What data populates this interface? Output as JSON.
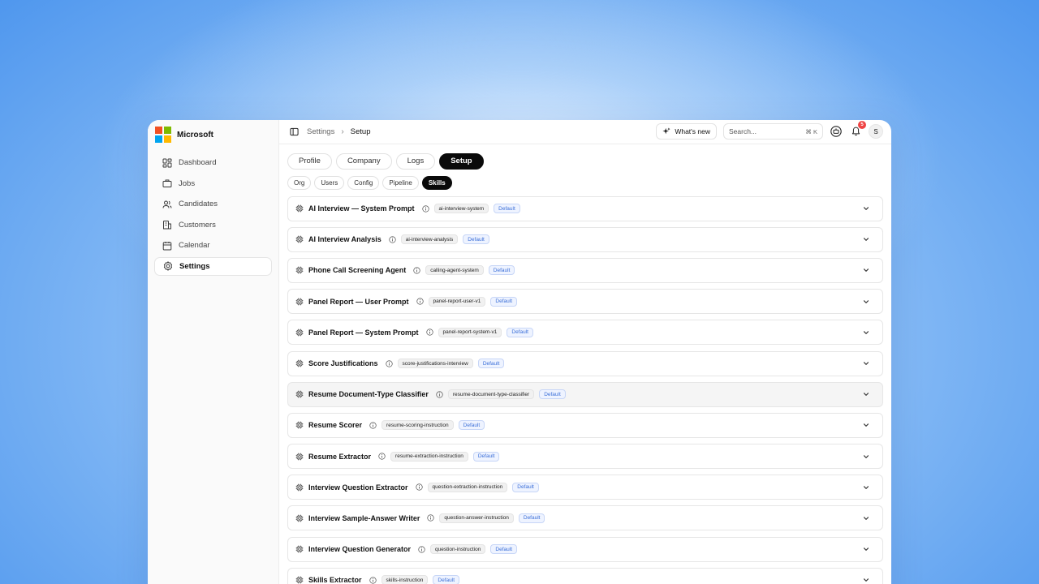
{
  "brand": {
    "name": "Microsoft",
    "logo_colors": [
      "#f25022",
      "#7fba00",
      "#00a4ef",
      "#ffb900"
    ]
  },
  "sidebar": {
    "items": [
      {
        "label": "Dashboard",
        "icon": "dashboard-icon"
      },
      {
        "label": "Jobs",
        "icon": "briefcase-icon"
      },
      {
        "label": "Candidates",
        "icon": "users-icon"
      },
      {
        "label": "Customers",
        "icon": "building-icon"
      },
      {
        "label": "Calendar",
        "icon": "calendar-icon"
      },
      {
        "label": "Settings",
        "icon": "gear-icon",
        "active": true
      }
    ]
  },
  "topbar": {
    "breadcrumb": [
      "Settings",
      "Setup"
    ],
    "whats_new": "What's new",
    "search_placeholder": "Search...",
    "search_shortcut": "⌘ K",
    "notification_count": "5",
    "avatar_initial": "S"
  },
  "tabs": [
    "Profile",
    "Company",
    "Logs",
    "Setup"
  ],
  "active_tab": "Setup",
  "subtabs": [
    "Org",
    "Users",
    "Config",
    "Pipeline",
    "Skills"
  ],
  "active_subtab": "Skills",
  "skills": [
    {
      "title": "AI Interview — System Prompt",
      "code": "ai-interview-system",
      "badge": "Default"
    },
    {
      "title": "AI Interview Analysis",
      "code": "ai-interview-analysis",
      "badge": "Default"
    },
    {
      "title": "Phone Call Screening Agent",
      "code": "calling-agent-system",
      "badge": "Default"
    },
    {
      "title": "Panel Report — User Prompt",
      "code": "panel-report-user-v1",
      "badge": "Default"
    },
    {
      "title": "Panel Report — System Prompt",
      "code": "panel-report-system-v1",
      "badge": "Default"
    },
    {
      "title": "Score Justifications",
      "code": "score-justifications-interview",
      "badge": "Default"
    },
    {
      "title": "Resume Document-Type Classifier",
      "code": "resume-document-type-classifier",
      "badge": "Default",
      "hover": true
    },
    {
      "title": "Resume Scorer",
      "code": "resume-scoring-instruction",
      "badge": "Default"
    },
    {
      "title": "Resume Extractor",
      "code": "resume-extraction-instruction",
      "badge": "Default"
    },
    {
      "title": "Interview Question Extractor",
      "code": "question-extraction-instruction",
      "badge": "Default"
    },
    {
      "title": "Interview Sample-Answer Writer",
      "code": "question-answer-instruction",
      "badge": "Default"
    },
    {
      "title": "Interview Question Generator",
      "code": "question-instruction",
      "badge": "Default"
    },
    {
      "title": "Skills Extractor",
      "code": "skills-instruction",
      "badge": "Default"
    }
  ]
}
